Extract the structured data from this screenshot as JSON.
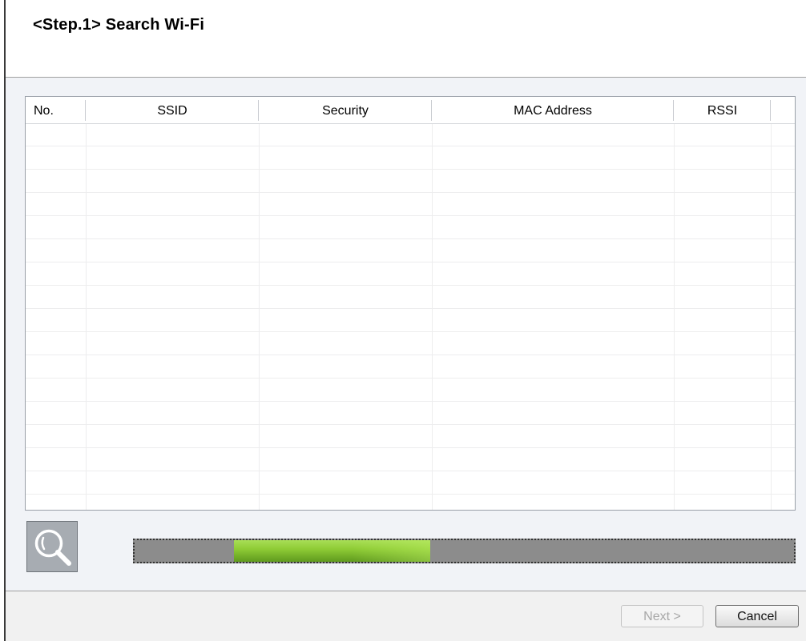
{
  "header": {
    "step_title": "<Step.1>  Search Wi-Fi"
  },
  "table": {
    "columns": [
      "No.",
      "SSID",
      "Security",
      "MAC Address",
      "RSSI",
      ""
    ],
    "rows": []
  },
  "search_button": {
    "icon": "magnifier-icon"
  },
  "progress": {
    "start_fraction": 0.151,
    "end_fraction": 0.449,
    "fill_color": "#8fcc36"
  },
  "footer": {
    "next_label": "Next >",
    "next_enabled": false,
    "cancel_label": "Cancel"
  }
}
